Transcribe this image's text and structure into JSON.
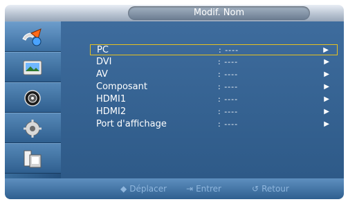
{
  "title": "Modif. Nom",
  "sidebar": {
    "items": [
      {
        "icon": "input-icon",
        "active": true
      },
      {
        "icon": "picture-icon",
        "active": false
      },
      {
        "icon": "sound-icon",
        "active": false
      },
      {
        "icon": "setup-icon",
        "active": false
      },
      {
        "icon": "multi-control-icon",
        "active": false
      }
    ]
  },
  "menu": {
    "items": [
      {
        "label": "PC",
        "value": ": ----",
        "arrow": "▶"
      },
      {
        "label": "DVI",
        "value": ": ----",
        "arrow": "▶"
      },
      {
        "label": "AV",
        "value": ": ----",
        "arrow": "▶"
      },
      {
        "label": "Composant",
        "value": ": ----",
        "arrow": "▶"
      },
      {
        "label": "HDMI1",
        "value": ": ----",
        "arrow": "▶"
      },
      {
        "label": "HDMI2",
        "value": ": ----",
        "arrow": "▶"
      },
      {
        "label": "Port d'affichage",
        "value": ": ----",
        "arrow": "▶"
      }
    ],
    "selected_index": 0
  },
  "footer": {
    "move": {
      "icon": "updown-icon",
      "label": "Déplacer"
    },
    "enter": {
      "icon": "enter-icon",
      "label": "Entrer"
    },
    "return": {
      "icon": "return-icon",
      "label": "Retour"
    }
  },
  "colors": {
    "accent": "#e8c21e",
    "panel": "#2f5f8f"
  }
}
